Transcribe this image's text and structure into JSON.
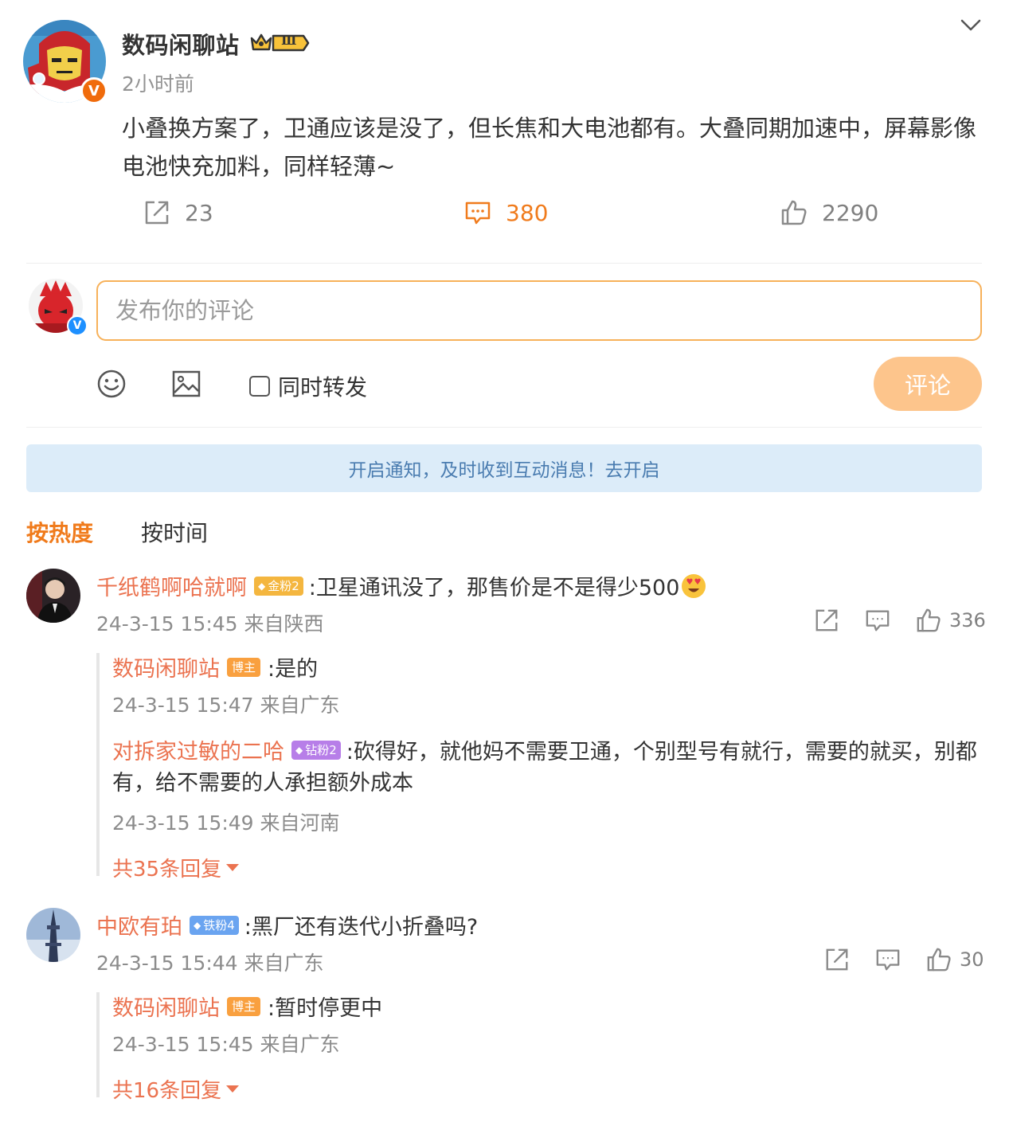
{
  "post": {
    "author": "数码闲聊站",
    "level_badge": "Ⅲ",
    "time": "2小时前",
    "text": "小叠换方案了，卫通应该是没了，但长焦和大电池都有。大叠同期加速中，屏幕影像电池快充加料，同样轻薄~",
    "verified_badge": "V",
    "actions": {
      "shares": "23",
      "comments": "380",
      "likes": "2290"
    },
    "colors": {
      "accent": "#f07b1c",
      "verified": "#f06b0b"
    }
  },
  "composer": {
    "placeholder": "发布你的评论",
    "verified_badge": "V",
    "repost_label": "同时转发",
    "submit_label": "评论",
    "icons": [
      "emoji-icon",
      "image-icon"
    ]
  },
  "notice": {
    "text": "开启通知，及时收到互动消息！去开启"
  },
  "sort_tabs": {
    "hot": "按热度",
    "time": "按时间"
  },
  "comments": [
    {
      "user": "千纸鹤啊哈就啊",
      "badge": "金粉2",
      "text": ":卫星通讯没了，那售价是不是得少500",
      "emoji": "heart-eyes-emoji",
      "meta": "24-3-15 15:45 来自陕西",
      "likes": "336",
      "replies": [
        {
          "user": "数码闲聊站",
          "badge": "博主",
          "text": ":是的",
          "meta": "24-3-15 15:47 来自广东"
        },
        {
          "user": "对拆家过敏的二哈",
          "badge": "钻粉2",
          "text": ":砍得好，就他妈不需要卫通，个别型号有就行，需要的就买，别都",
          "text2": "有，给不需要的人承担额外成本",
          "meta": "24-3-15 15:49 来自河南"
        }
      ],
      "more": "共35条回复"
    },
    {
      "user": "中欧有珀",
      "badge": "铁粉4",
      "text": ":黑厂还有迭代小折叠吗?",
      "meta": "24-3-15 15:44 来自广东",
      "likes": "30",
      "replies": [
        {
          "user": "数码闲聊站",
          "badge": "博主",
          "text": ":暂时停更中",
          "meta": "24-3-15 15:45 来自广东"
        }
      ],
      "more": "共16条回复"
    }
  ]
}
